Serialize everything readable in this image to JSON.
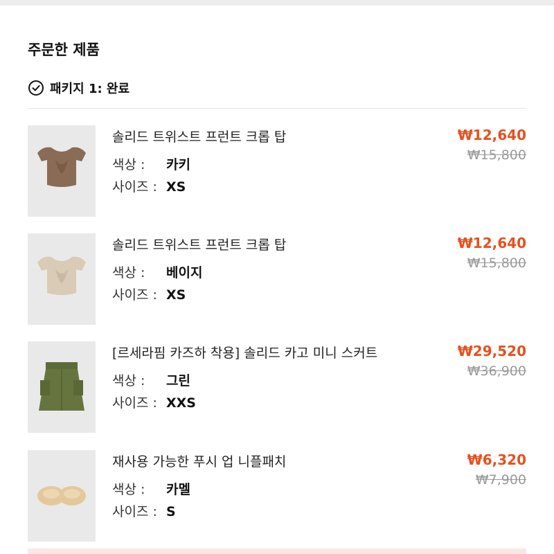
{
  "section": {
    "title": "주문한 제품"
  },
  "package": {
    "label": "패키지 1: 완료"
  },
  "attr_labels": {
    "color": "색상 :",
    "size": "사이즈 :"
  },
  "colors": {
    "price": "#e8501f",
    "original_price": "#9a9a9a",
    "thumb_bg": "#e9e9e9"
  },
  "items": [
    {
      "name": "솔리드 트위스트 프런트 크롭 탑",
      "color": "카키",
      "size": "XS",
      "price": "₩12,640",
      "original_price": "₩15,800",
      "image_icon": "khaki-crop-top-image"
    },
    {
      "name": "솔리드 트위스트 프런트 크롭 탑",
      "color": "베이지",
      "size": "XS",
      "price": "₩12,640",
      "original_price": "₩15,800",
      "image_icon": "beige-crop-top-image"
    },
    {
      "name": "[르세라핌 카즈하 착용] 솔리드 카고 미니 스커트",
      "color": "그린",
      "size": "XXS",
      "price": "₩29,520",
      "original_price": "₩36,900",
      "image_icon": "green-cargo-skirt-image"
    },
    {
      "name": "재사용 가능한 푸시 업 니플패치",
      "color": "카멜",
      "size": "S",
      "price": "₩6,320",
      "original_price": "₩7,900",
      "image_icon": "camel-nipple-patch-image"
    }
  ]
}
